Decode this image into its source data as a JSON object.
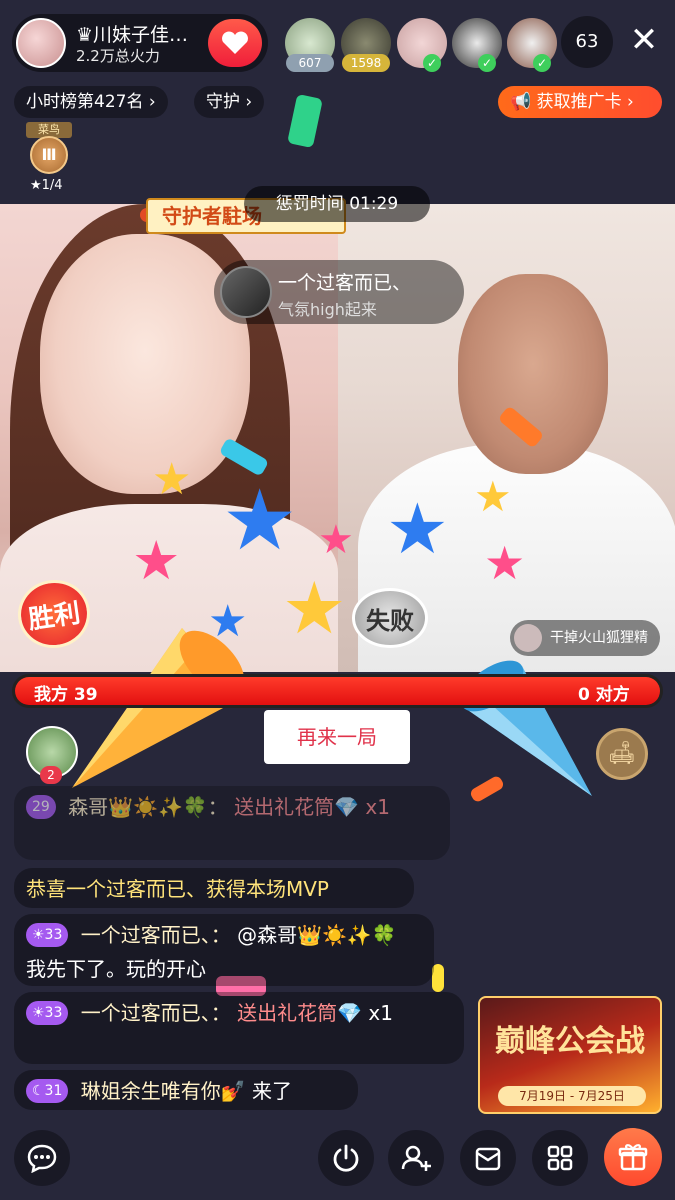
{
  "header": {
    "host_name": "♛川妹子佳…",
    "host_fire": "2.2万总火力",
    "viewers": [
      {
        "badge": "607",
        "badge_color": "#8fa0b0"
      },
      {
        "badge": "1598",
        "badge_color": "#d6b53a"
      },
      {
        "badge": "",
        "badge_color": ""
      },
      {
        "badge": "",
        "badge_color": ""
      },
      {
        "badge": "",
        "badge_color": ""
      }
    ],
    "viewer_count": "63",
    "close_icon": "✕"
  },
  "sub_header": {
    "rank_label": "小时榜第427名 ›",
    "guard_label": "守护 ›",
    "promo_label": "📢 获取推广卡 ›",
    "medal_title": "菜鸟",
    "medal_level": "Ⅲ",
    "medal_progress": "★1/4"
  },
  "pk": {
    "punish_timer": "惩罚时间 01:29",
    "guard_banner": "守护者駐场",
    "gift_toast_name": "一个过客而已、",
    "gift_toast_msg": "气氛high起来",
    "win_label": "胜利",
    "lose_label": "失败",
    "opponent_name": "干掉火山狐狸精",
    "my_label": "我方 39",
    "their_label": "0 对方",
    "my_share": 1.0,
    "again_button": "再来一局",
    "left_avatar_badge": "2"
  },
  "chat": {
    "msg1_level": "29",
    "msg1_user": "森哥👑☀️✨🍀：",
    "msg1_text": "送出礼花筒💎 x1",
    "msg2_text": "恭喜一个过客而已、获得本场MVP",
    "msg3_level": "☀33",
    "msg3_user": "一个过客而已、：",
    "msg3_text": "@森哥👑☀️✨🍀 我先下了。玩的开心",
    "msg4_level": "☀33",
    "msg4_user": "一个过客而已、：",
    "msg4_gift": "送出礼花筒💎",
    "msg4_count": "x1",
    "msg5_level": "☾31",
    "msg5_user": "琳姐余生唯有你💅",
    "msg5_text": "来了"
  },
  "event": {
    "title": "巅峰公会战",
    "date": "7月19日 - 7月25日"
  },
  "colors": {
    "background": "#27273a",
    "accent": "#ff4d2e",
    "pk_red": "#e21010",
    "level_purple": "#a55af0"
  }
}
